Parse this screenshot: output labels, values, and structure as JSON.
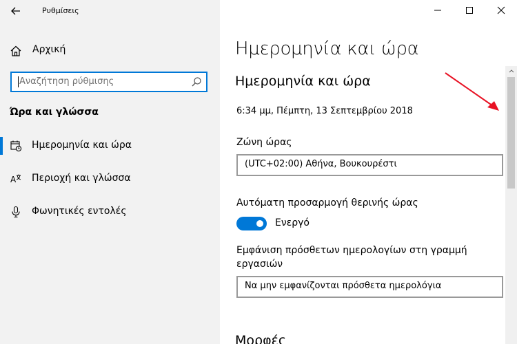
{
  "window": {
    "app_title": "Ρυθμίσεις"
  },
  "sidebar": {
    "home_label": "Αρχική",
    "search_placeholder": "Αναζήτηση ρύθμισης",
    "section_title": "Ώρα και γλώσσα",
    "items": [
      {
        "label": "Ημερομηνία και ώρα",
        "icon": "calendar-clock-icon",
        "active": true
      },
      {
        "label": "Περιοχή και γλώσσα",
        "icon": "language-icon",
        "active": false
      },
      {
        "label": "Φωνητικές εντολές",
        "icon": "microphone-icon",
        "active": false
      }
    ]
  },
  "main": {
    "page_title": "Ημερομηνία και ώρα",
    "section_title": "Ημερομηνία και ώρα",
    "current_datetime": "6:34 μμ, Πέμπτη, 13 Σεπτεμβρίου 2018",
    "timezone_label": "Ζώνη ώρας",
    "timezone_value": "(UTC+02:00) Αθήνα, Βουκουρέστι",
    "dst_label": "Αυτόματη προσαρμογή θερινής ώρας",
    "dst_state": "Ενεργό",
    "extra_calendars_label": "Εμφάνιση πρόσθετων ημερολογίων στη γραμμή εργασιών",
    "extra_calendars_value": "Να μην εμφανίζονται πρόσθετα ημερολόγια",
    "next_section_title": "Μορφές"
  },
  "colors": {
    "accent": "#0078d7",
    "sidebar_bg": "#f2f2f2",
    "annotation_arrow": "#e81123"
  }
}
